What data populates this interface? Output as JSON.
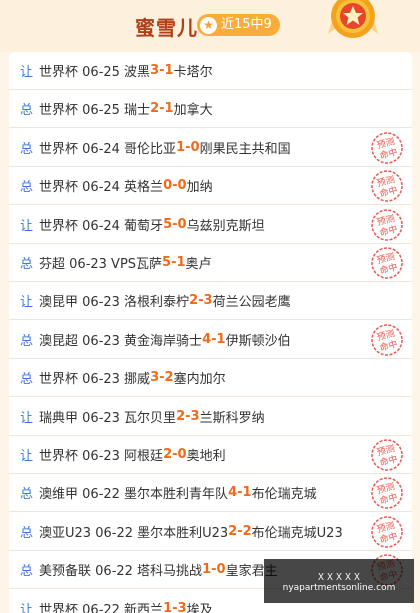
{
  "header": {
    "title": "蜜雪儿",
    "record": "近15中9",
    "star_icon": "star-icon",
    "medal_icon": "star-medal-icon"
  },
  "stamp_text": [
    "预测",
    "命中"
  ],
  "matches": [
    {
      "tag": "让",
      "text": "世界杯 06-25 波黑",
      "home_score": "3",
      "sep": " - ",
      "away_score": "1",
      "away": "卡塔尔",
      "hit": false
    },
    {
      "tag": "总",
      "text": "世界杯 06-25 瑞士",
      "home_score": "2",
      "sep": " - ",
      "away_score": "1",
      "away": "加拿大",
      "hit": false
    },
    {
      "tag": "总",
      "text": "世界杯 06-24 哥伦比亚",
      "home_score": "1",
      "sep": " - ",
      "away_score": "0",
      "away": "刚果民主共和国",
      "hit": true
    },
    {
      "tag": "总",
      "text": "世界杯 06-24 英格兰",
      "home_score": "0",
      "sep": " - ",
      "away_score": "0",
      "away": "加纳",
      "hit": true
    },
    {
      "tag": "让",
      "text": "世界杯 06-24 葡萄牙",
      "home_score": "5",
      "sep": " - ",
      "away_score": "0",
      "away": "乌兹别克斯坦",
      "hit": true
    },
    {
      "tag": "总",
      "text": "芬超 06-23 VPS瓦萨",
      "home_score": "5",
      "sep": " - ",
      "away_score": "1",
      "away": "奥卢",
      "hit": true
    },
    {
      "tag": "让",
      "text": "澳昆甲 06-23 洛根利泰柠",
      "home_score": "2",
      "sep": " - ",
      "away_score": "3",
      "away": "荷兰公园老鹰",
      "hit": false
    },
    {
      "tag": "总",
      "text": "澳昆超 06-23 黄金海岸骑士",
      "home_score": "4",
      "sep": " - ",
      "away_score": "1",
      "away": "伊斯顿沙伯",
      "hit": true
    },
    {
      "tag": "总",
      "text": "世界杯 06-23 挪威",
      "home_score": "3",
      "sep": " - ",
      "away_score": "2",
      "away": "塞内加尔",
      "hit": false
    },
    {
      "tag": "让",
      "text": "瑞典甲 06-23 瓦尔贝里",
      "home_score": "2",
      "sep": " - ",
      "away_score": "3",
      "away": "兰斯科罗纳",
      "hit": false
    },
    {
      "tag": "让",
      "text": "世界杯 06-23 阿根廷",
      "home_score": "2",
      "sep": " - ",
      "away_score": "0",
      "away": "奥地利",
      "hit": true
    },
    {
      "tag": "总",
      "text": "澳维甲 06-22 墨尔本胜利青年队",
      "home_score": "4",
      "sep": " - ",
      "away_score": "1",
      "away": "布伦瑞克城",
      "hit": true
    },
    {
      "tag": "总",
      "text": "澳亚U23 06-22 墨尔本胜利U23",
      "home_score": "2",
      "sep": " - ",
      "away_score": "2",
      "away": "布伦瑞克城U23",
      "hit": true
    },
    {
      "tag": "总",
      "text": "美预备联 06-22 塔科马挑战",
      "home_score": "1",
      "sep": " - ",
      "away_score": "0",
      "away": "皇家君主",
      "hit": true
    },
    {
      "tag": "让",
      "text": "世界杯 06-22 新西兰",
      "home_score": "1",
      "sep": " - ",
      "away_score": "3",
      "away": "埃及",
      "hit": false
    }
  ],
  "watermark": {
    "line1": "ＸＸＸＸＸ",
    "line2": "nyapartmentsonline.com"
  }
}
